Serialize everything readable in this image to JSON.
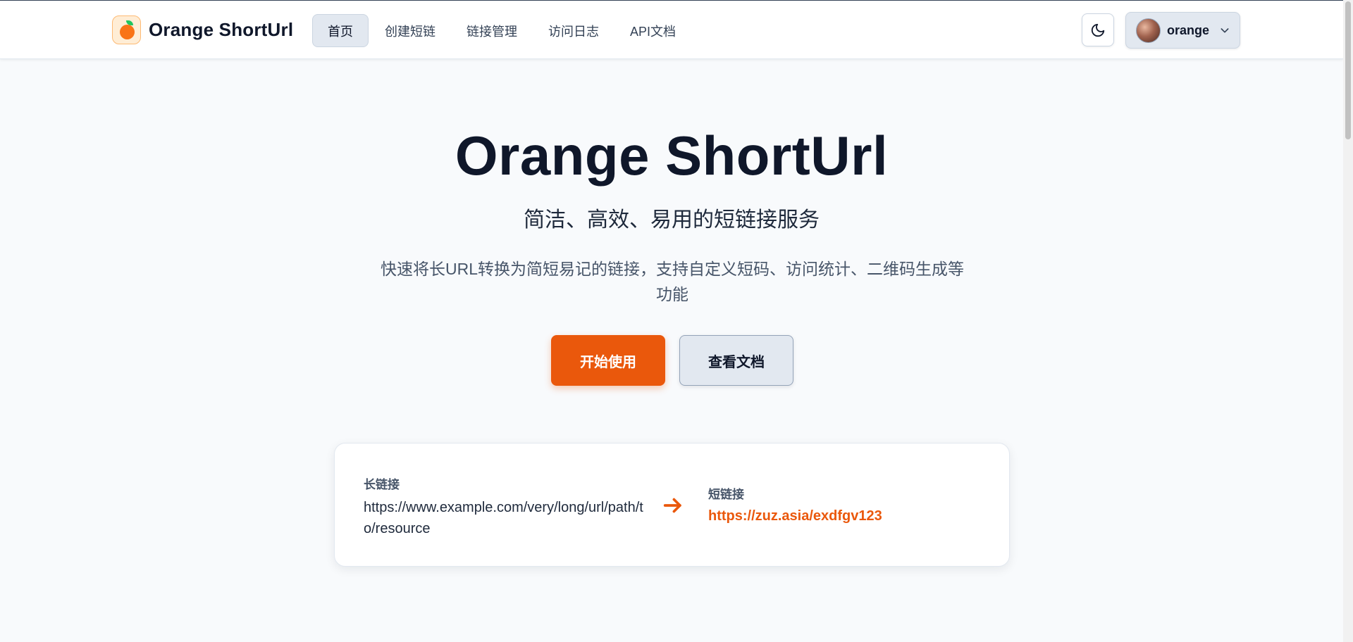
{
  "brand": {
    "name": "Orange ShortUrl",
    "logo_icon": "orange-fruit-icon",
    "accent_color": "#ea580c"
  },
  "nav": {
    "items": [
      {
        "label": "首页",
        "active": true
      },
      {
        "label": "创建短链",
        "active": false
      },
      {
        "label": "链接管理",
        "active": false
      },
      {
        "label": "访问日志",
        "active": false
      },
      {
        "label": "API文档",
        "active": false
      }
    ]
  },
  "header": {
    "theme_toggle_icon": "moon-icon",
    "user": {
      "name": "orange",
      "dropdown_icon": "chevron-down-icon"
    }
  },
  "hero": {
    "title": "Orange ShortUrl",
    "subtitle": "简洁、高效、易用的短链接服务",
    "description": "快速将长URL转换为简短易记的链接，支持自定义短码、访问统计、二维码生成等功能",
    "primary_button": "开始使用",
    "secondary_button": "查看文档"
  },
  "demo": {
    "long_label": "长链接",
    "long_url": "https://www.example.com/very/long/url/path/to/resource",
    "arrow_icon": "arrow-right-icon",
    "short_label": "短链接",
    "short_url": "https://zuz.asia/exdfgv123"
  }
}
